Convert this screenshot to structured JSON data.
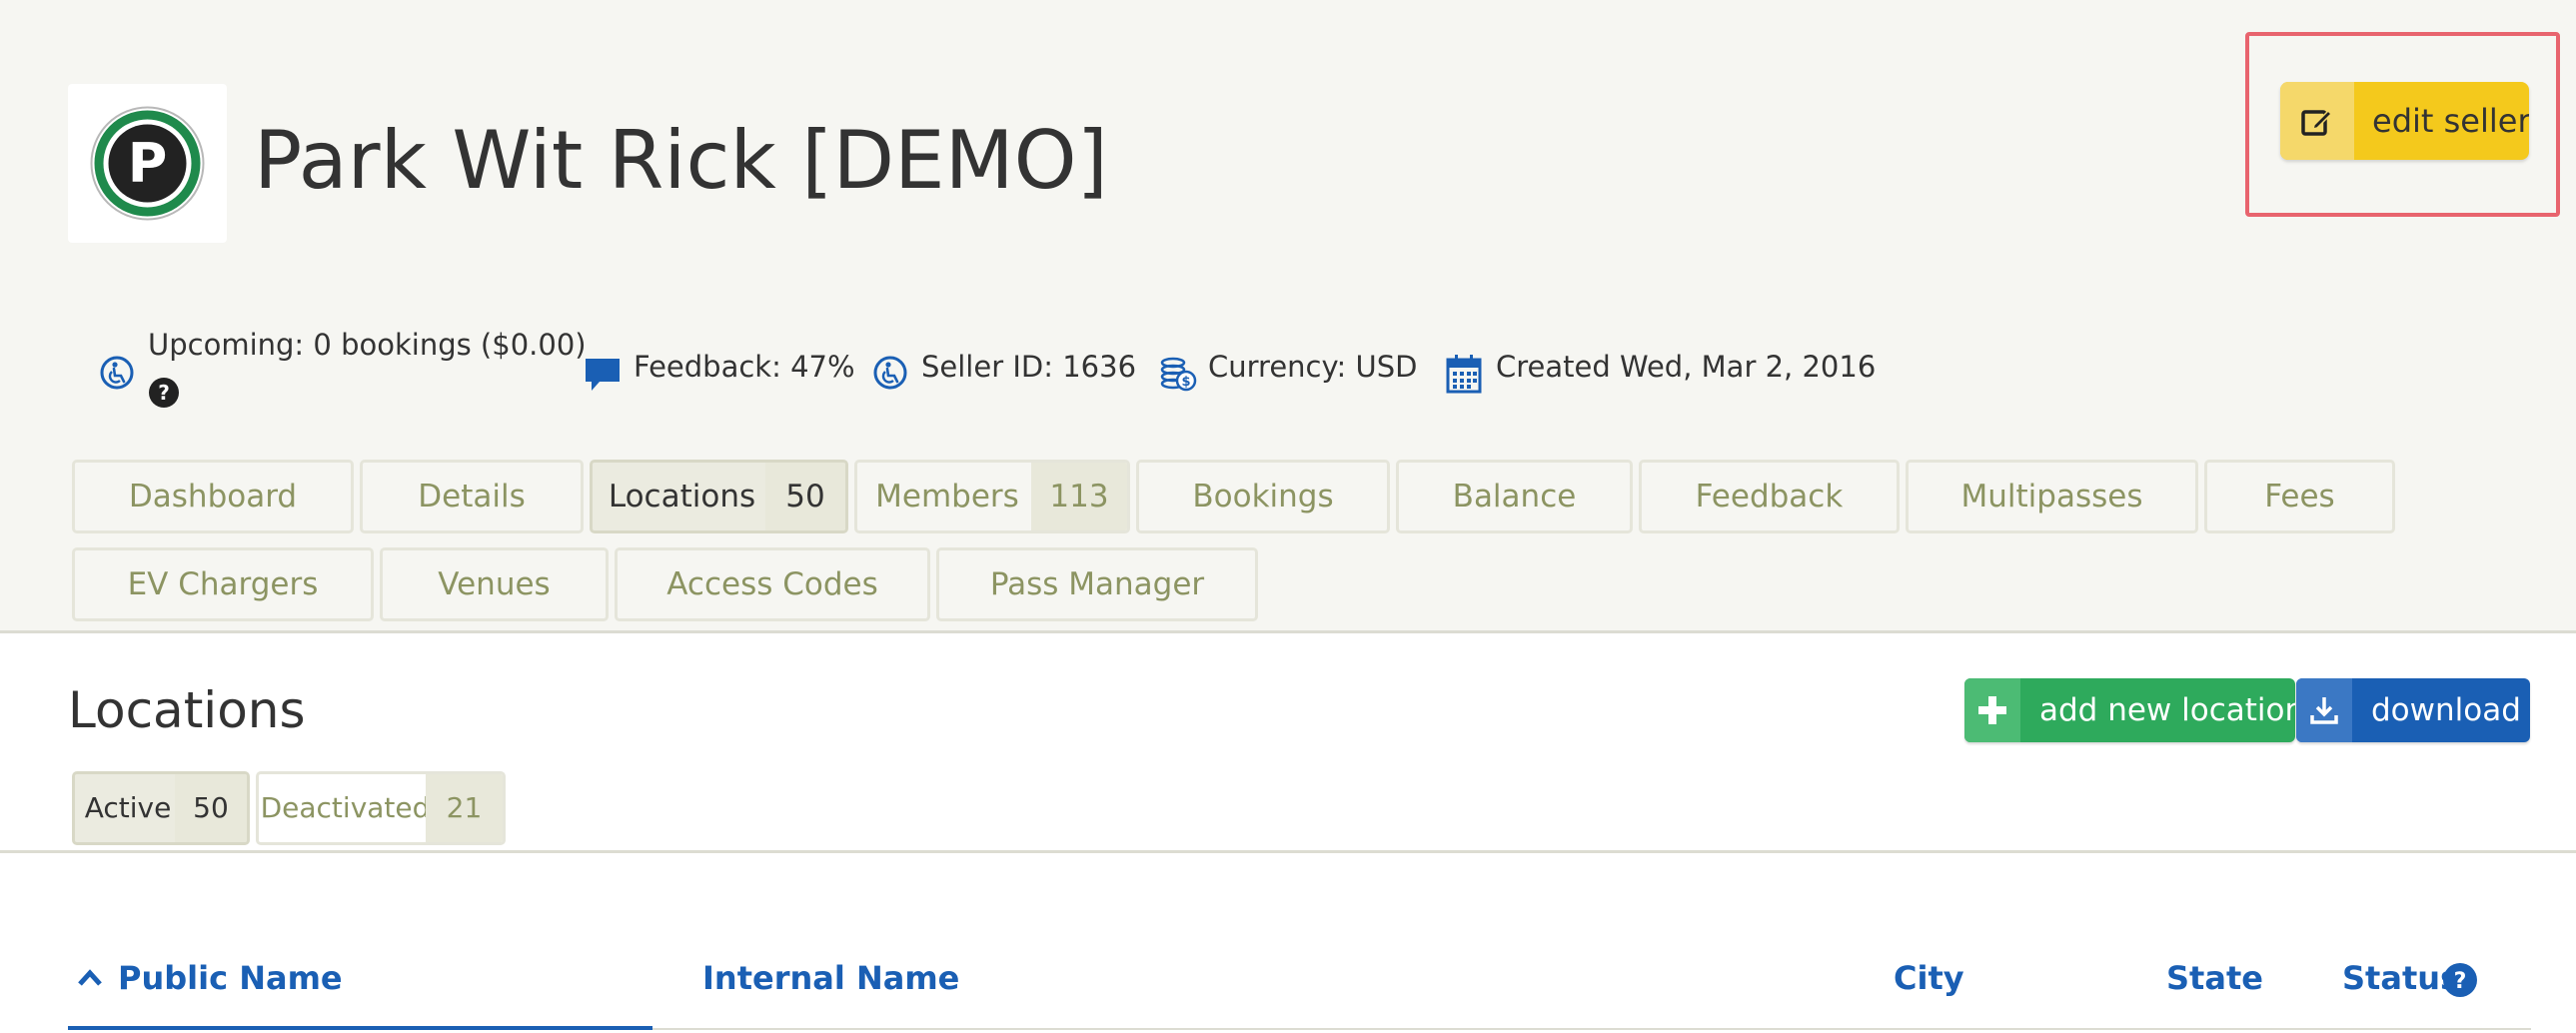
{
  "seller": {
    "name": "Park Wit Rick [DEMO]",
    "logo_letter": "P",
    "edit_label": "edit seller"
  },
  "meta": {
    "upcoming": "Upcoming: 0 bookings ($0.00)",
    "feedback": "Feedback: 47%",
    "seller_id": "Seller ID: 1636",
    "currency": "Currency: USD",
    "created": "Created Wed, Mar 2, 2016"
  },
  "tabs": [
    {
      "label": "Dashboard"
    },
    {
      "label": "Details"
    },
    {
      "label": "Locations",
      "count": "50",
      "active": true
    },
    {
      "label": "Members",
      "count": "113"
    },
    {
      "label": "Bookings"
    },
    {
      "label": "Balance"
    },
    {
      "label": "Feedback"
    },
    {
      "label": "Multipasses"
    },
    {
      "label": "Fees"
    },
    {
      "label": "EV Chargers"
    },
    {
      "label": "Venues"
    },
    {
      "label": "Access Codes"
    },
    {
      "label": "Pass Manager"
    }
  ],
  "locations": {
    "title": "Locations",
    "add_label": "add new location",
    "download_label": "download",
    "subtabs": [
      {
        "label": "Active",
        "count": "50",
        "active": true
      },
      {
        "label": "Deactivated",
        "count": "21"
      }
    ],
    "columns": [
      "Public Name",
      "Internal Name",
      "City",
      "State",
      "Status"
    ]
  },
  "colors": {
    "edit_button": "#f4c91c",
    "add_button": "#2eaa5c",
    "download_button": "#1a5fb4",
    "tab_text": "#8c9462",
    "link_blue": "#1a5fb4",
    "highlight": "#e8646e"
  }
}
